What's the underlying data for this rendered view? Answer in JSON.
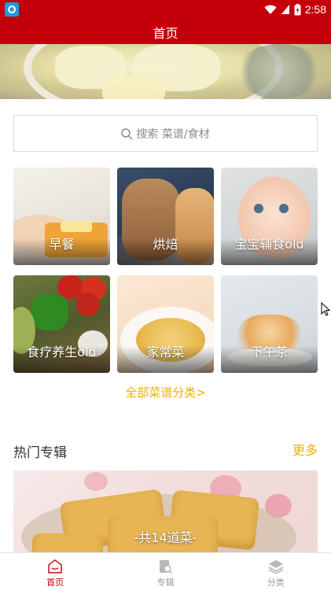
{
  "status_bar": {
    "time": "2:58"
  },
  "app_bar": {
    "title": "首页"
  },
  "search": {
    "placeholder": "搜索 菜谱/食材"
  },
  "categories": [
    {
      "label": "早餐"
    },
    {
      "label": "烘焙"
    },
    {
      "label": "宝宝辅食old"
    },
    {
      "label": "食疗养生old"
    },
    {
      "label": "家常菜"
    },
    {
      "label": "下午茶"
    }
  ],
  "all_categories_link": "全部菜谱分类>",
  "hot_albums": {
    "title": "热门专辑",
    "more_label": "更多",
    "items": [
      {
        "caption": "-共14道菜-"
      }
    ]
  },
  "tab_bar": {
    "tabs": [
      {
        "label": "首页",
        "icon": "home-icon",
        "active": true
      },
      {
        "label": "专辑",
        "icon": "album-icon",
        "active": false
      },
      {
        "label": "分类",
        "icon": "category-icon",
        "active": false
      }
    ]
  },
  "colors": {
    "primary": "#c4000b",
    "accent": "#f0b000"
  }
}
